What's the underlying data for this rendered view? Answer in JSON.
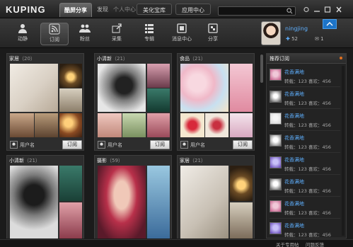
{
  "app": {
    "logo": "KUPING"
  },
  "top_nav": {
    "items": [
      {
        "label": "酷屏分享",
        "active": true
      },
      {
        "label": "发现",
        "active": false
      },
      {
        "label": "个人中心",
        "active": false
      },
      {
        "label": "美化宝库",
        "active": false
      },
      {
        "label": "应用中心",
        "active": false
      }
    ]
  },
  "search": {
    "value": "",
    "placeholder": ""
  },
  "toolbar": {
    "items": [
      {
        "label": "动静",
        "icon": "user-icon"
      },
      {
        "label": "订阅",
        "icon": "rss-icon",
        "active": true
      },
      {
        "label": "粉丝",
        "icon": "fans-icon"
      },
      {
        "label": "采集",
        "icon": "share-arrow-icon"
      },
      {
        "label": "专辑",
        "icon": "list-icon"
      },
      {
        "label": "消息中心",
        "icon": "message-icon"
      },
      {
        "label": "分享",
        "icon": "share-icon"
      }
    ]
  },
  "profile": {
    "username": "ningjing",
    "follow_count": "52",
    "message_count": "1"
  },
  "cards": [
    {
      "title": "家居",
      "count": "（20）",
      "user": "用户名",
      "button": "订阅"
    },
    {
      "title": "小清新",
      "count": "（21）",
      "user": "用户名",
      "button": "订阅"
    },
    {
      "title": "食品",
      "count": "（21）",
      "user": "用户名",
      "button": "订阅"
    },
    {
      "title": "小清新",
      "count": "（21）",
      "user": "",
      "button": ""
    },
    {
      "title": "摄影",
      "count": "（59）",
      "user": "",
      "button": ""
    },
    {
      "title": "家居",
      "count": "（21）",
      "user": "",
      "button": ""
    }
  ],
  "panel": {
    "title": "推荐订阅",
    "items": [
      {
        "name": "花香满地",
        "stat": "转载：123  喜欢：456"
      },
      {
        "name": "花香满地",
        "stat": "转载：123  喜欢：456"
      },
      {
        "name": "花香满地",
        "stat": "转载：123  喜欢：456"
      },
      {
        "name": "花香满地",
        "stat": "转载：123  喜欢：456"
      },
      {
        "name": "花香满地",
        "stat": "转载：123  喜欢：456"
      },
      {
        "name": "花香满地",
        "stat": "转载：123  喜欢：456"
      },
      {
        "name": "花香满地",
        "stat": "转载：123  喜欢：456"
      },
      {
        "name": "花香满地",
        "stat": "转载：123  喜欢：456"
      }
    ]
  },
  "status_bar": {
    "links": [
      "关于专用帖",
      "问题反馈"
    ]
  },
  "colors": {
    "accent": "#1d74c8",
    "link": "#5fb0ff",
    "background": "#1b1b1b"
  }
}
